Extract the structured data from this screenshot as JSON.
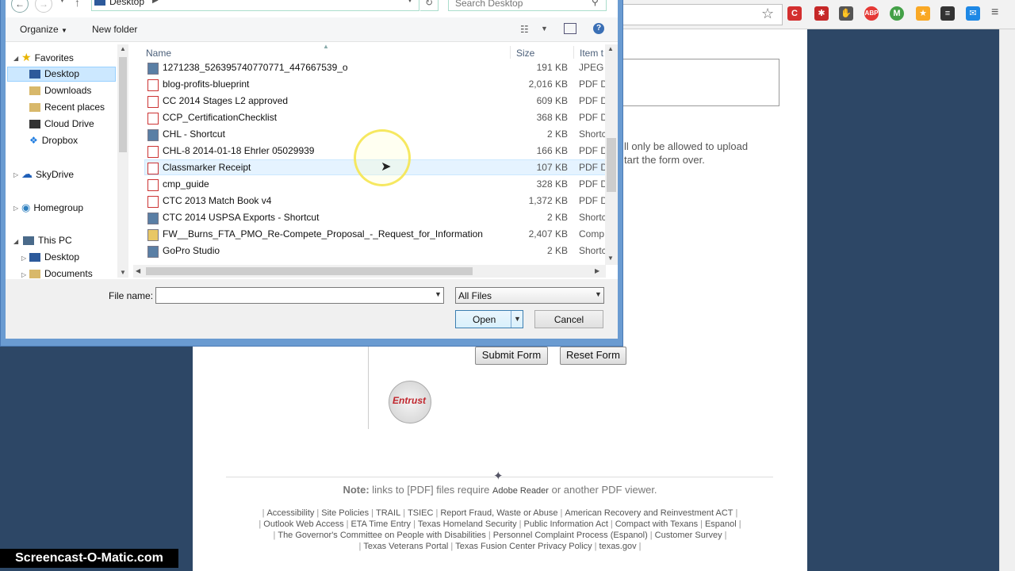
{
  "dialog": {
    "path": "Desktop",
    "search_placeholder": "Search Desktop",
    "organize": "Organize",
    "new_folder": "New folder",
    "nav": [
      {
        "label": "Favorites"
      },
      {
        "label": "Desktop"
      },
      {
        "label": "Downloads"
      },
      {
        "label": "Recent places"
      },
      {
        "label": "Cloud Drive"
      },
      {
        "label": "Dropbox"
      },
      {
        "label": "SkyDrive"
      },
      {
        "label": "Homegroup"
      },
      {
        "label": "This PC"
      },
      {
        "label": "Desktop"
      },
      {
        "label": "Documents"
      }
    ],
    "columns": {
      "name": "Name",
      "size": "Size",
      "type": "Item t"
    },
    "files": [
      {
        "name": "1271238_526395740770771_447667539_o",
        "size": "191 KB",
        "type": "JPEG i"
      },
      {
        "name": "blog-profits-blueprint",
        "size": "2,016 KB",
        "type": "PDF D"
      },
      {
        "name": "CC 2014 Stages L2 approved",
        "size": "609 KB",
        "type": "PDF D"
      },
      {
        "name": "CCP_CertificationChecklist",
        "size": "368 KB",
        "type": "PDF D"
      },
      {
        "name": "CHL - Shortcut",
        "size": "2 KB",
        "type": "Shortc"
      },
      {
        "name": "CHL-8 2014-01-18 Ehrler 05029939",
        "size": "166 KB",
        "type": "PDF D"
      },
      {
        "name": "Classmarker Receipt",
        "size": "107 KB",
        "type": "PDF D"
      },
      {
        "name": "cmp_guide",
        "size": "328 KB",
        "type": "PDF D"
      },
      {
        "name": "CTC 2013 Match Book v4",
        "size": "1,372 KB",
        "type": "PDF D"
      },
      {
        "name": "CTC 2014 USPSA Exports - Shortcut",
        "size": "2 KB",
        "type": "Shortc"
      },
      {
        "name": "FW__Burns_FTA_PMO_Re-Compete_Proposal_-_Request_for_Information",
        "size": "2,407 KB",
        "type": "Comp"
      },
      {
        "name": "GoPro Studio",
        "size": "2 KB",
        "type": "Shortc"
      }
    ],
    "file_name_label": "File name:",
    "file_name_value": "",
    "file_type": "All Files",
    "open_label": "Open",
    "cancel_label": "Cancel"
  },
  "page": {
    "upload_note_1": "ll only be allowed to upload",
    "upload_note_2": "tart the form over.",
    "submit_label": "Submit Form",
    "reset_label": "Reset Form",
    "seal_text": "Entrust",
    "note_bold": "Note:",
    "note_text": "links to [PDF] files require",
    "note_link": "Adobe Reader",
    "note_tail": "or another PDF viewer.",
    "footer_row1": [
      "Accessibility",
      "Site Policies",
      "TRAIL",
      "TSIEC",
      "Report Fraud, Waste or Abuse",
      "American Recovery and Reinvestment ACT"
    ],
    "footer_row2": [
      "Outlook Web Access",
      "ETA Time Entry",
      "Texas Homeland Security",
      "Public Information Act",
      "Compact with Texans",
      "Espanol"
    ],
    "footer_row3": [
      "The Governor's Committee on People with Disabilities",
      "Personnel Complaint Process (Espanol)",
      "Customer Survey"
    ],
    "footer_row4": [
      "Texas Veterans Portal",
      "Texas Fusion Center Privacy Policy",
      "texas.gov"
    ]
  },
  "watermark": "Screencast-O-Matic.com",
  "colors": {
    "accent": "#6a9bd1",
    "page_bg": "#2d4766",
    "selection": "#cce8ff"
  }
}
